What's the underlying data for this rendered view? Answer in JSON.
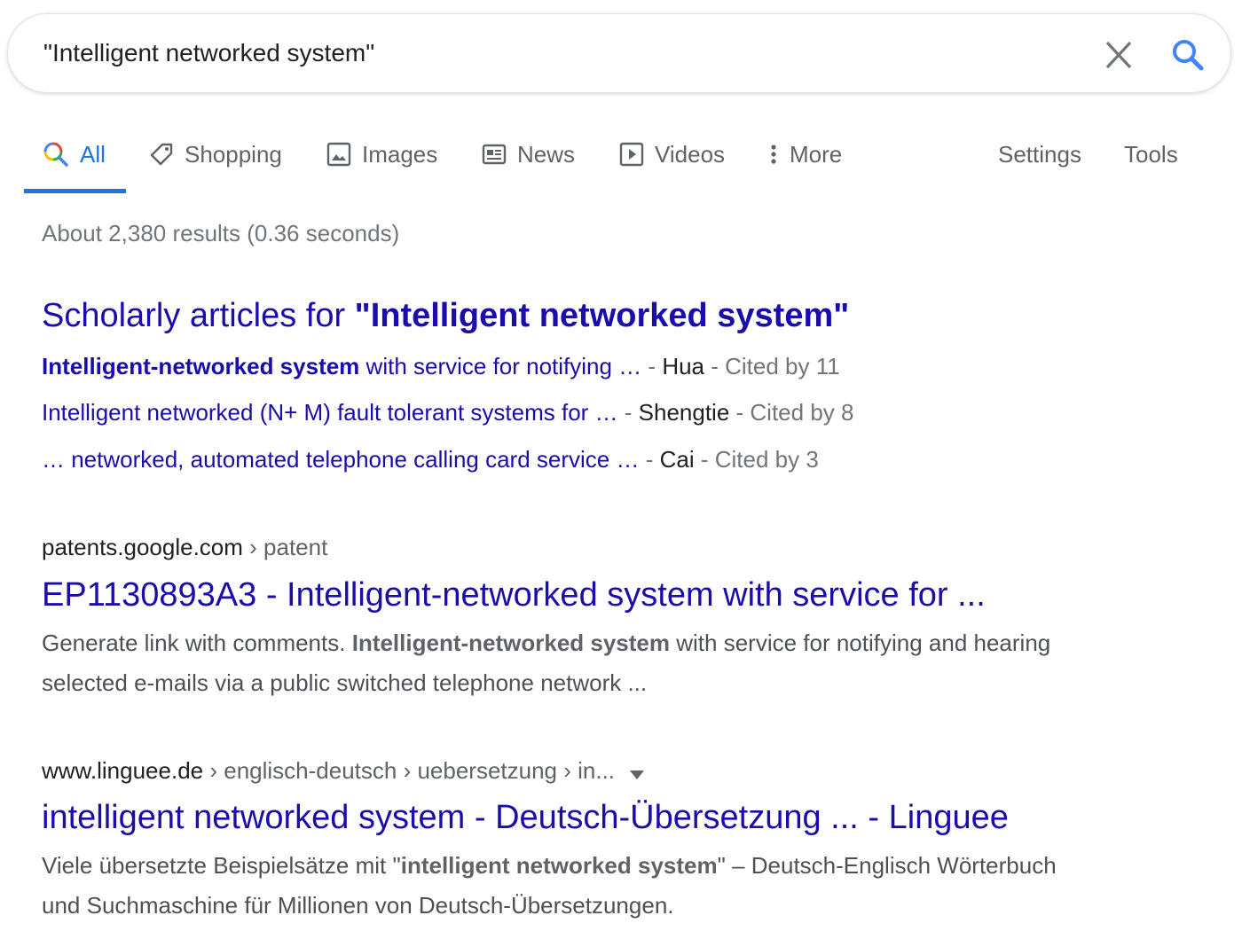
{
  "search": {
    "query": "\"Intelligent networked system\""
  },
  "tabs": [
    {
      "label": "All",
      "icon": "search-icon",
      "active": true
    },
    {
      "label": "Shopping",
      "icon": "tag-icon"
    },
    {
      "label": "Images",
      "icon": "image-icon"
    },
    {
      "label": "News",
      "icon": "newspaper-icon"
    },
    {
      "label": "Videos",
      "icon": "play-icon"
    },
    {
      "label": "More",
      "icon": "more-vert-icon"
    }
  ],
  "tools": {
    "settings": "Settings",
    "tools": "Tools"
  },
  "result_stats": "About 2,380 results (0.36 seconds)",
  "scholar": {
    "title_prefix": "Scholarly articles for ",
    "title_query": "\"Intelligent networked system\"",
    "items": [
      {
        "bold": "Intelligent-networked system",
        "rest": " with service for notifying …",
        "sep1": " - ",
        "author": "Hua",
        "sep2": " - ",
        "cited": "Cited by 11"
      },
      {
        "bold": "",
        "rest": "Intelligent networked (N+ M) fault tolerant systems for …",
        "sep1": " - ",
        "author": "Shengtie",
        "sep2": " - ",
        "cited": "Cited by 8"
      },
      {
        "bold": "",
        "rest": "… networked, automated telephone calling card service …",
        "sep1": " - ",
        "author": "Cai",
        "sep2": " - ",
        "cited": "Cited by 3"
      }
    ]
  },
  "results": [
    {
      "domain": "patents.google.com",
      "path": " › patent",
      "title": "EP1130893A3 - Intelligent-networked system with service for ...",
      "snippet_pre": "Generate link with comments. ",
      "snippet_bold": "Intelligent-networked system",
      "snippet_post": " with service for notifying and hearing selected e-mails via a public switched telephone network ..."
    },
    {
      "domain": "www.linguee.de",
      "path": " › englisch-deutsch › uebersetzung › in...",
      "title": "intelligent networked system - Deutsch-Übersetzung ... - Linguee",
      "snippet_pre": "Viele übersetzte Beispielsätze mit \"",
      "snippet_bold": "intelligent networked system",
      "snippet_post": "\" – Deutsch-Englisch Wörterbuch und Suchmaschine für Millionen von Deutsch-Übersetzungen."
    }
  ],
  "colors": {
    "link": "#1a0dab",
    "accent": "#1a73e8",
    "muted": "#70757a"
  }
}
